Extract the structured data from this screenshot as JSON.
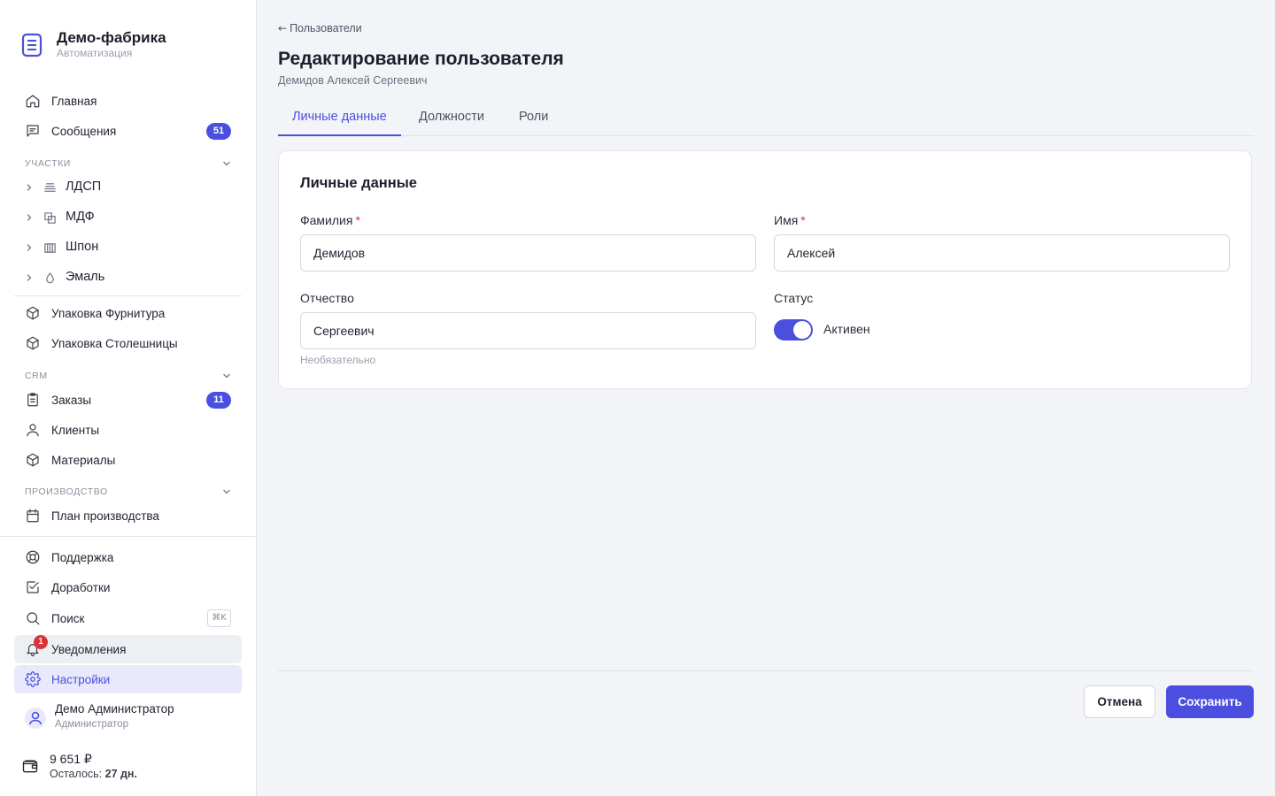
{
  "brand": {
    "title": "Демо-фабрика",
    "subtitle": "Автоматизация"
  },
  "sidebar": {
    "main_items": [
      {
        "label": "Главная",
        "icon": "home-icon"
      },
      {
        "label": "Сообщения",
        "icon": "message-icon",
        "badge": "51"
      }
    ],
    "sections": {
      "areas": "Участки",
      "crm": "CRM",
      "production": "Производство"
    },
    "areas": [
      {
        "label": "ЛДСП",
        "icon": "layers-icon"
      },
      {
        "label": "МДФ",
        "icon": "stack-icon"
      },
      {
        "label": "Шпон",
        "icon": "veneer-icon"
      },
      {
        "label": "Эмаль",
        "icon": "drop-icon"
      }
    ],
    "packaging": [
      {
        "label": "Упаковка Фурнитура",
        "icon": "box-icon"
      },
      {
        "label": "Упаковка Столешницы",
        "icon": "box-icon"
      }
    ],
    "crm_items": [
      {
        "label": "Заказы",
        "icon": "clipboard-icon",
        "badge": "11"
      },
      {
        "label": "Клиенты",
        "icon": "user-icon"
      },
      {
        "label": "Материалы",
        "icon": "cube-icon"
      }
    ],
    "production_items": [
      {
        "label": "План производства",
        "icon": "calendar-icon"
      }
    ],
    "bottom_items": {
      "support": "Поддержка",
      "improvements": "Доработки",
      "search": "Поиск",
      "search_kbd": "⌘K",
      "notifications": "Уведомления",
      "notifications_count": "1",
      "settings": "Настройки"
    },
    "user": {
      "name": "Демо Администратор",
      "role": "Администратор"
    },
    "wallet": {
      "amount": "9 651 ₽",
      "left_label": "Осталось:",
      "left_value": "27 дн."
    }
  },
  "main": {
    "back_label": "Пользователи",
    "title": "Редактирование пользователя",
    "subtitle": "Демидов Алексей Сергеевич",
    "tabs": [
      {
        "label": "Личные данные",
        "active": true
      },
      {
        "label": "Должности",
        "active": false
      },
      {
        "label": "Роли",
        "active": false
      }
    ],
    "card": {
      "title": "Личные данные",
      "last_name": {
        "label": "Фамилия",
        "required_mark": "*",
        "value": "Демидов"
      },
      "first_name": {
        "label": "Имя",
        "required_mark": "*",
        "value": "Алексей"
      },
      "middle_name": {
        "label": "Отчество",
        "value": "Сергеевич",
        "hint": "Необязательно"
      },
      "status": {
        "label": "Статус",
        "value": "Активен",
        "enabled": true
      }
    },
    "actions": {
      "cancel": "Отмена",
      "save": "Сохранить"
    }
  },
  "colors": {
    "accent": "#4b4fe0",
    "danger": "#d8333a",
    "background": "#f3f4f7"
  }
}
